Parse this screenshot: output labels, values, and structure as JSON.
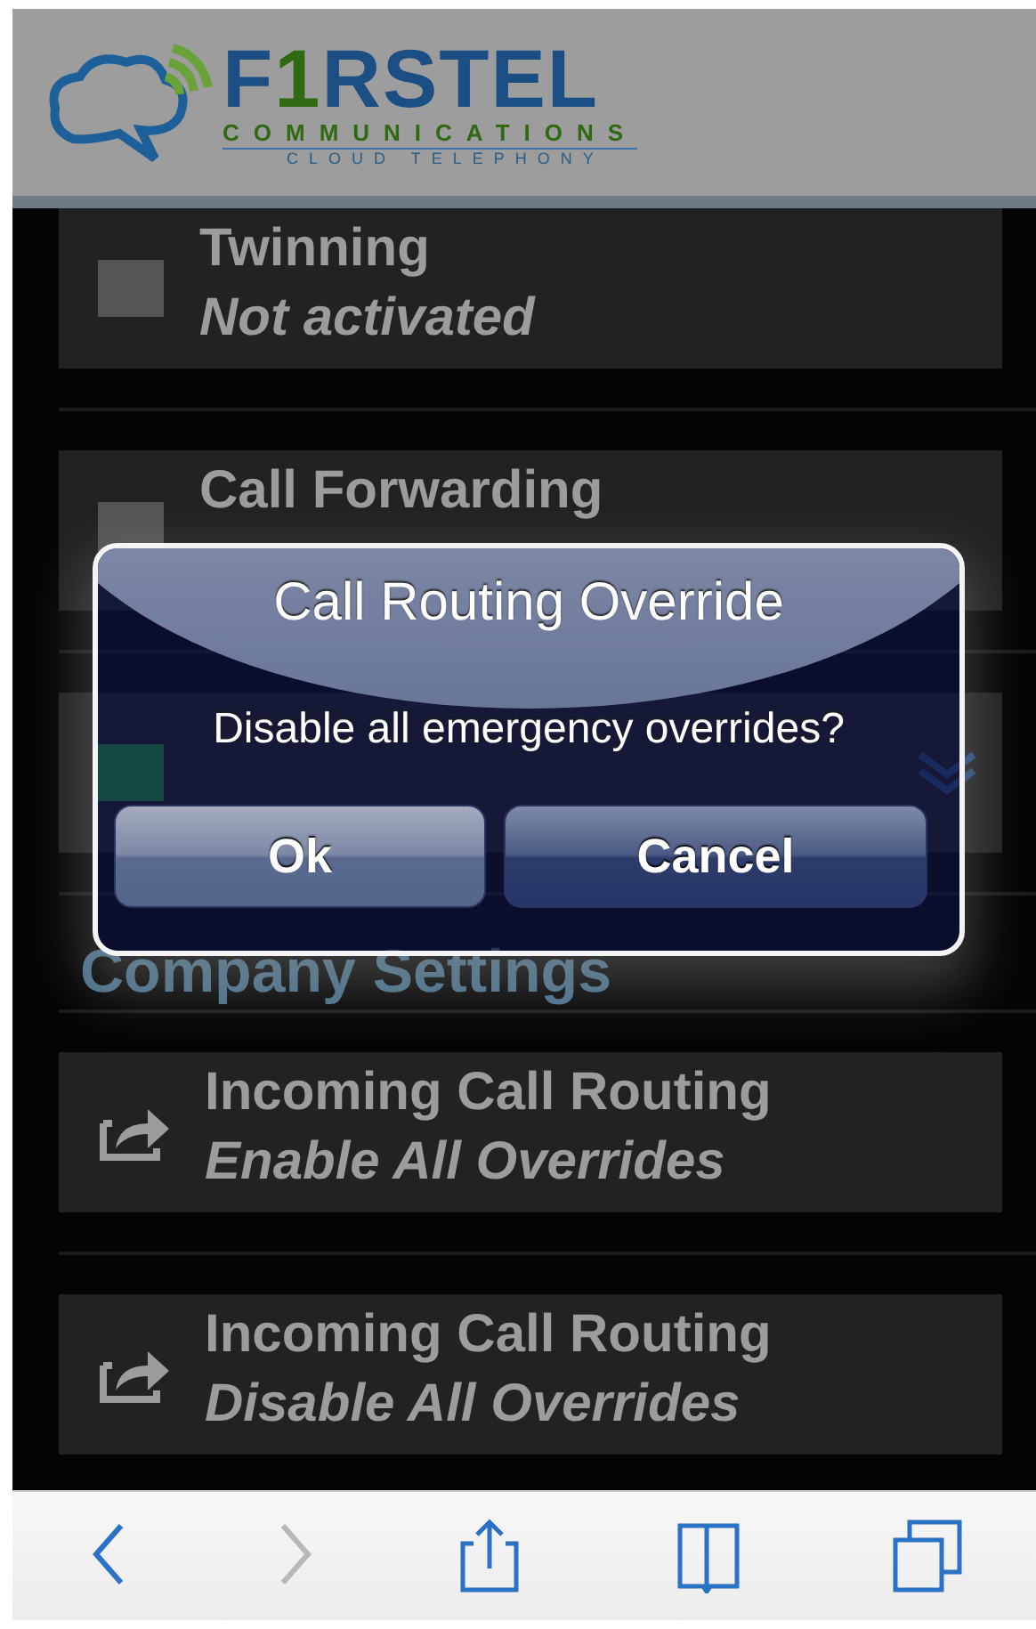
{
  "logo": {
    "name": "F1RSTEL",
    "tagline": "COMMUNICATIONS",
    "subline": "CLOUD TELEPHONY"
  },
  "settings": [
    {
      "kind": "checkbox",
      "title": "Twinning",
      "subtitle": "Not activated",
      "checked": false
    },
    {
      "kind": "checkbox",
      "title": "Call Forwarding",
      "checked": false
    },
    {
      "kind": "dropdown",
      "checked": true
    }
  ],
  "section_heading": "Company Settings",
  "actions": [
    {
      "title": "Incoming Call Routing",
      "subtitle": "Enable All Overrides"
    },
    {
      "title": "Incoming Call Routing",
      "subtitle": "Disable All Overrides"
    }
  ],
  "dialog": {
    "title": "Call Routing Override",
    "message": "Disable all emergency overrides?",
    "buttons": [
      {
        "label": "Ok",
        "kind": "plain"
      },
      {
        "label": "Cancel",
        "kind": "cancel"
      }
    ]
  },
  "toolbar": [
    {
      "kind": "back",
      "disabled": false
    },
    {
      "kind": "forward",
      "disabled": true
    },
    {
      "kind": "share",
      "disabled": false
    },
    {
      "kind": "bookmarks",
      "disabled": false
    },
    {
      "kind": "tabs",
      "disabled": false
    }
  ]
}
